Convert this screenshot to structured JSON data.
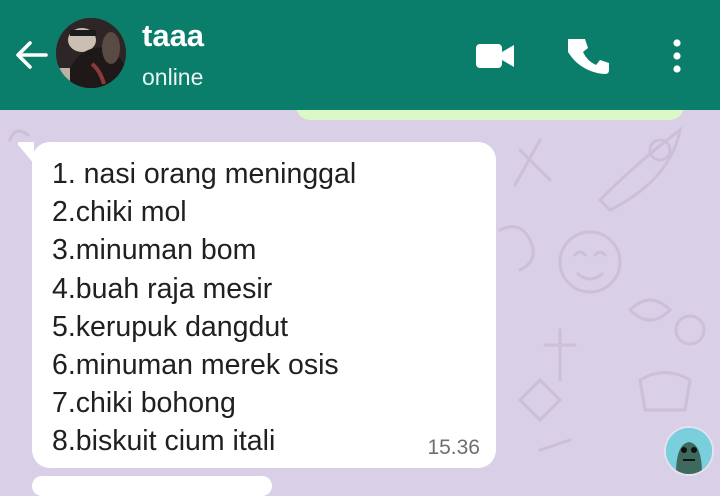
{
  "header": {
    "contact_name": "taaa",
    "status": "online",
    "icons": {
      "back": "arrow-left-icon",
      "video": "video-call-icon",
      "call": "phone-icon",
      "menu": "more-vertical-icon"
    }
  },
  "message": {
    "lines": [
      "1. nasi orang meninggal",
      "2.chiki mol",
      "3.minuman bom",
      "4.buah raja mesir",
      "5.kerupuk dangdut",
      "6.minuman merek osis",
      "7.chiki bohong",
      "8.biskuit cium itali"
    ],
    "time": "15.36"
  },
  "colors": {
    "header": "#0b7e6b",
    "background": "#d9cfe6",
    "incoming_bubble": "#ffffff",
    "outgoing_bubble": "#dcf8c6"
  }
}
